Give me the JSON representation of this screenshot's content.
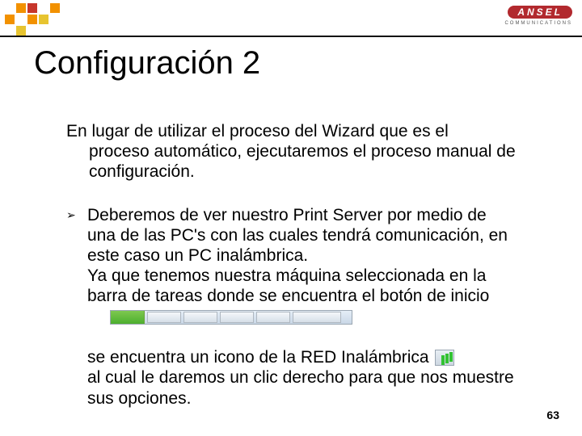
{
  "logo": {
    "brand": "ANSEL",
    "sub": "COMMUNICATIONS"
  },
  "title": "Configuración 2",
  "intro_line1": "En lugar de utilizar el proceso del Wizard que es el",
  "intro_rest": "proceso automático, ejecutaremos el proceso manual de configuración.",
  "bullet_p1": "Deberemos de ver nuestro Print Server por medio de una de las PC's con las cuales tendrá comunicación, en este caso un PC inalámbrica.",
  "bullet_p2": " Ya que tenemos nuestra máquina seleccionada en la barra de tareas donde se encuentra el botón de inicio",
  "after_line1": "se encuentra un icono de la RED Inalámbrica",
  "after_rest": "al cual le daremos un clic derecho para que nos muestre sus opciones.",
  "page_number": "63"
}
